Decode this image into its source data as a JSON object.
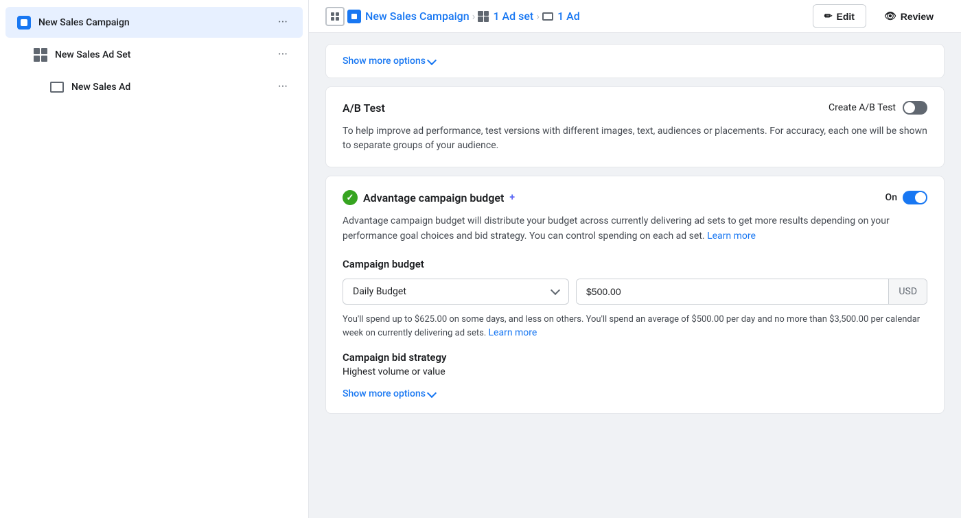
{
  "sidebar": {
    "items": [
      {
        "id": "campaign",
        "label": "New Sales Campaign",
        "icon": "campaign-icon",
        "active": true,
        "level": 0
      },
      {
        "id": "adset",
        "label": "New Sales Ad Set",
        "icon": "adset-icon",
        "active": false,
        "level": 1
      },
      {
        "id": "ad",
        "label": "New Sales Ad",
        "icon": "ad-icon",
        "active": false,
        "level": 2
      }
    ]
  },
  "topnav": {
    "breadcrumb": [
      {
        "label": "New Sales Campaign",
        "type": "campaign"
      },
      {
        "label": "1 Ad set",
        "type": "adset"
      },
      {
        "label": "1 Ad",
        "type": "ad"
      }
    ],
    "edit_label": "Edit",
    "review_label": "Review"
  },
  "show_more_top": "Show more options",
  "ab_test": {
    "title": "A/B Test",
    "create_label": "Create A/B Test",
    "toggle_checked": false,
    "description": "To help improve ad performance, test versions with different images, text, audiences or placements. For accuracy, each one will be shown to separate groups of your audience."
  },
  "advantage_budget": {
    "title": "Advantage campaign budget",
    "plus_symbol": "+",
    "on_label": "On",
    "toggle_checked": true,
    "description": "Advantage campaign budget will distribute your budget across currently delivering ad sets to get more results depending on your performance goal choices and bid strategy. You can control spending on each ad set.",
    "learn_more": "Learn more",
    "campaign_budget_label": "Campaign budget",
    "budget_type": "Daily Budget",
    "budget_amount": "$500.00",
    "budget_currency": "USD",
    "budget_note": "You'll spend up to $625.00 on some days, and less on others. You'll spend an average of $500.00 per day and no more than $3,500.00 per calendar week on currently delivering ad sets.",
    "budget_note_learn_more": "Learn more",
    "bid_strategy_label": "Campaign bid strategy",
    "bid_strategy_value": "Highest volume or value"
  },
  "show_more_bottom": "Show more options"
}
